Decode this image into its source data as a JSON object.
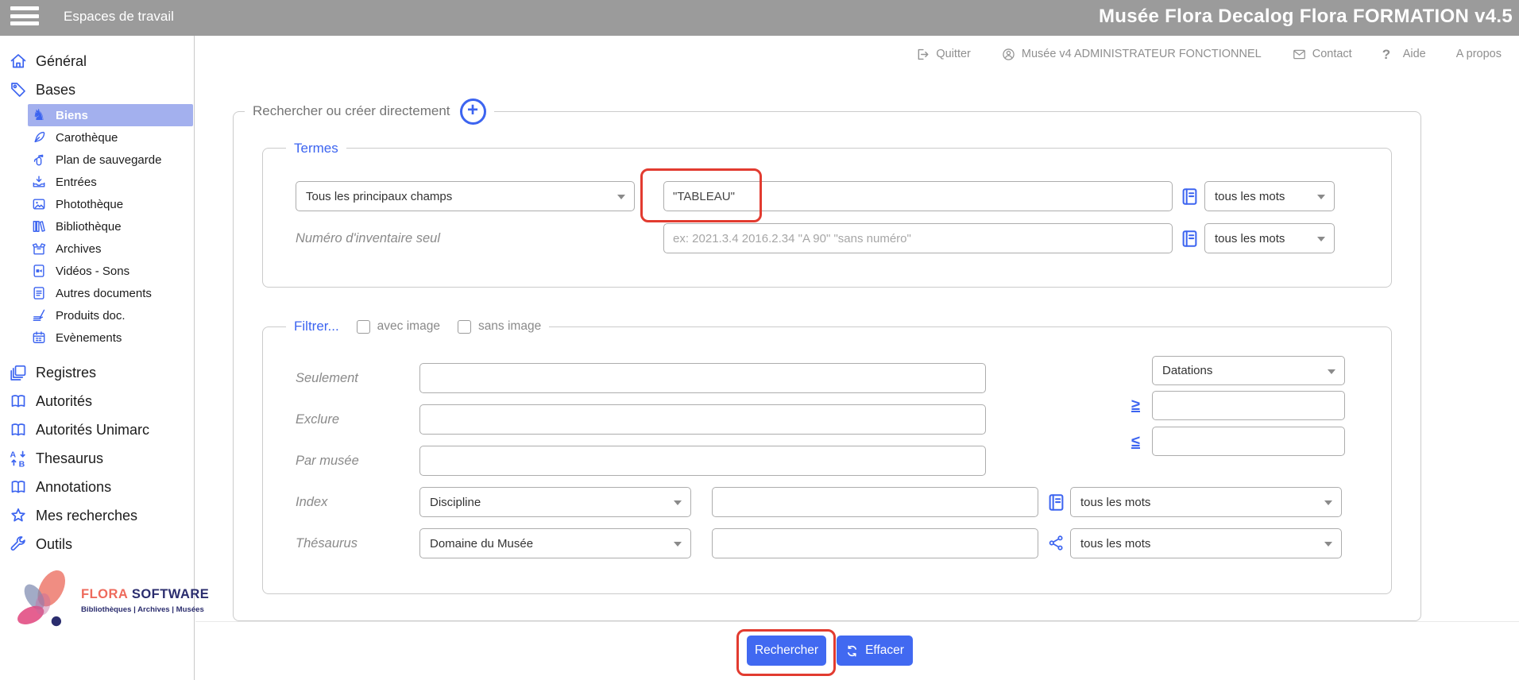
{
  "topbar": {
    "workspace_label": "Espaces de travail",
    "title": "Musée Flora Decalog Flora FORMATION v4.5"
  },
  "header": {
    "links": [
      {
        "icon": "logout",
        "label": "Quitter",
        "name": "quitter"
      },
      {
        "icon": "user",
        "label": "Musée v4 ADMINISTRATEUR FONCTIONNEL",
        "name": "user-account"
      },
      {
        "icon": "mail",
        "label": "Contact",
        "name": "contact"
      },
      {
        "icon": "help",
        "label": "Aide",
        "name": "aide"
      },
      {
        "icon": "",
        "label": "A propos",
        "name": "a-propos"
      }
    ]
  },
  "sidebar": {
    "items": [
      {
        "icon": "home",
        "label": "Général",
        "level": 0,
        "selected": false
      },
      {
        "icon": "tag",
        "label": "Bases",
        "level": 0,
        "selected": false
      },
      {
        "icon": "knight",
        "label": "Biens",
        "level": 1,
        "selected": true
      },
      {
        "icon": "quill",
        "label": "Carothèque",
        "level": 1,
        "selected": false
      },
      {
        "icon": "extinguisher",
        "label": "Plan de sauvegarde",
        "level": 1,
        "selected": false
      },
      {
        "icon": "inbox",
        "label": "Entrées",
        "level": 1,
        "selected": false
      },
      {
        "icon": "image",
        "label": "Photothèque",
        "level": 1,
        "selected": false
      },
      {
        "icon": "books",
        "label": "Bibliothèque",
        "level": 1,
        "selected": false
      },
      {
        "icon": "archive",
        "label": "Archives",
        "level": 1,
        "selected": false
      },
      {
        "icon": "video-file",
        "label": "Vidéos - Sons",
        "level": 1,
        "selected": false
      },
      {
        "icon": "document",
        "label": "Autres documents",
        "level": 1,
        "selected": false
      },
      {
        "icon": "papers",
        "label": "Produits doc.",
        "level": 1,
        "selected": false
      },
      {
        "icon": "calendar",
        "label": "Evènements",
        "level": 1,
        "selected": false
      },
      {
        "icon": "registers",
        "label": "Registres",
        "level": 0,
        "selected": false,
        "groupGap": true
      },
      {
        "icon": "open-book",
        "label": "Autorités",
        "level": 0,
        "selected": false
      },
      {
        "icon": "open-book",
        "label": "Autorités Unimarc",
        "level": 0,
        "selected": false
      },
      {
        "icon": "sort-ab",
        "label": "Thesaurus",
        "level": 0,
        "selected": false
      },
      {
        "icon": "open-book",
        "label": "Annotations",
        "level": 0,
        "selected": false
      },
      {
        "icon": "star",
        "label": "Mes recherches",
        "level": 0,
        "selected": false
      },
      {
        "icon": "wrench",
        "label": "Outils",
        "level": 0,
        "selected": false
      }
    ],
    "logo": {
      "brand_flora": "FLORA",
      "brand_software": "SOFTWARE",
      "tagline": "Bibliothèques | Archives | Musées"
    }
  },
  "search_panel": {
    "legend": "Rechercher ou créer directement",
    "termes": {
      "legend": "Termes",
      "field_select_value": "Tous les principaux champs",
      "terms_value": "\"TABLEAU\"",
      "terms_mode_value": "tous les mots",
      "inventory_label": "Numéro d'inventaire seul",
      "inventory_placeholder": "ex: 2021.3.4 2016.2.34 \"A 90\" \"sans numéro\"",
      "inventory_mode_value": "tous les mots"
    },
    "filter": {
      "legend": "Filtrer...",
      "with_image_label": "avec image",
      "without_image_label": "sans image",
      "only_label": "Seulement",
      "exclude_label": "Exclure",
      "museum_label": "Par musée",
      "index_label": "Index",
      "index_select_value": "Discipline",
      "index_mode_value": "tous les mots",
      "thesaurus_label": "Thésaurus",
      "thesaurus_select_value": "Domaine du Musée",
      "thesaurus_mode_value": "tous les mots",
      "datations_select_value": "Datations",
      "gte_symbol": "≥",
      "lte_symbol": "≤"
    },
    "actions": {
      "search_label": "Rechercher",
      "clear_label": "Effacer"
    }
  },
  "colors": {
    "accent": "#3c64f0",
    "selected_row_bg": "#a3b0ee",
    "topbar_bg": "#9b9b9b",
    "button_bg": "#4169f1",
    "annotation_red": "#e23b30"
  }
}
